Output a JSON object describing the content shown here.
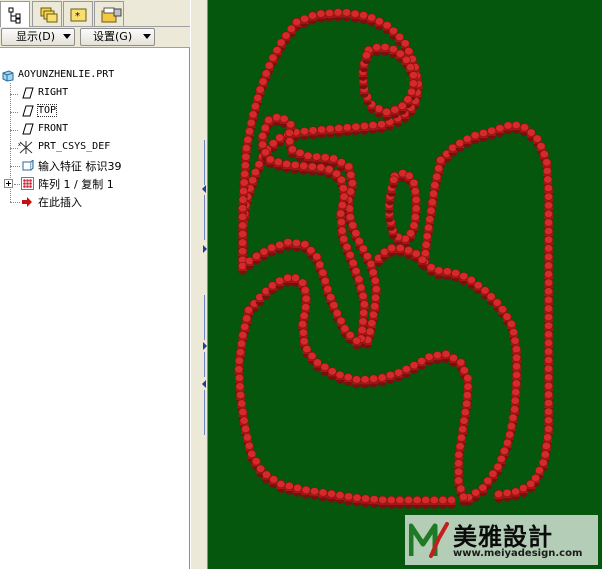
{
  "tabs": [
    {
      "icon": "model-tree-icon",
      "active": true
    },
    {
      "icon": "layers-icon",
      "active": false
    },
    {
      "icon": "favorites-icon",
      "active": false
    },
    {
      "icon": "folder-browser-icon",
      "active": false
    }
  ],
  "toolbar": {
    "display_label": "显示(D)",
    "settings_label": "设置(G)"
  },
  "tree": {
    "root": "AOYUNZHENLIE.PRT",
    "items": [
      {
        "label": "RIGHT",
        "icon": "datum-plane-icon"
      },
      {
        "label": "TOP",
        "icon": "datum-plane-icon"
      },
      {
        "label": "FRONT",
        "icon": "datum-plane-icon"
      },
      {
        "label": "PRT_CSYS_DEF",
        "icon": "coordinate-system-icon"
      },
      {
        "label": "输入特征 标识39",
        "icon": "import-feature-icon"
      },
      {
        "label": "阵列 1 / 复制 1",
        "icon": "pattern-icon"
      },
      {
        "label": "在此插入",
        "icon": "insert-here-arrow-icon"
      }
    ]
  },
  "watermark": {
    "title": "美雅設計",
    "url": "www.meiyadesign.com"
  },
  "colors": {
    "canvas_bg": "#04570c",
    "bead_fill": "#d42a2a",
    "bead_shadow": "#7a0f0f"
  }
}
